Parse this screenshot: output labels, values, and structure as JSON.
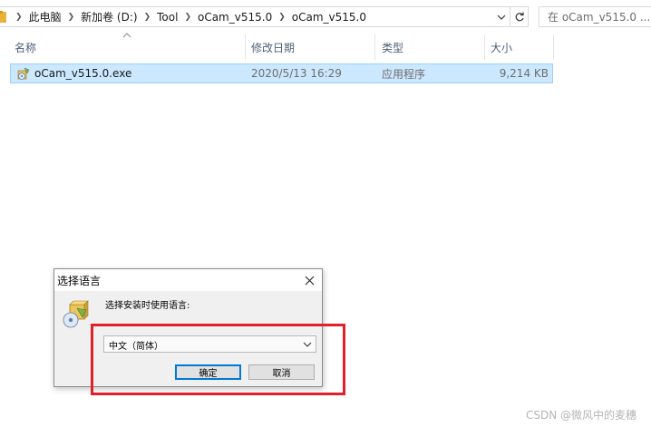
{
  "address_bar": {
    "breadcrumbs": [
      "此电脑",
      "新加卷 (D:)",
      "Tool",
      "oCam_v515.0",
      "oCam_v515.0"
    ],
    "search_placeholder": "在 oCam_v515.0 ..."
  },
  "columns": {
    "name": "名称",
    "modified": "修改日期",
    "type": "类型",
    "size": "大小"
  },
  "files": [
    {
      "name": "oCam_v515.0.exe",
      "modified": "2020/5/13 16:29",
      "type": "应用程序",
      "size": "9,214 KB"
    }
  ],
  "dialog": {
    "title": "选择语言",
    "prompt": "选择安装时使用语言:",
    "selected_language": "中文（简体）",
    "ok_label": "确定",
    "cancel_label": "取消"
  },
  "watermark": "CSDN @微风中的麦穗",
  "colors": {
    "selection_bg": "#cce8ff",
    "selection_border": "#99d1ff",
    "header_text": "#4c607a",
    "highlight_red": "#e0202a",
    "primary_button_border": "#0078d7"
  },
  "icons": {
    "folder": "folder-icon",
    "file": "exe-setup-icon",
    "refresh": "refresh-icon",
    "close": "close-icon"
  }
}
